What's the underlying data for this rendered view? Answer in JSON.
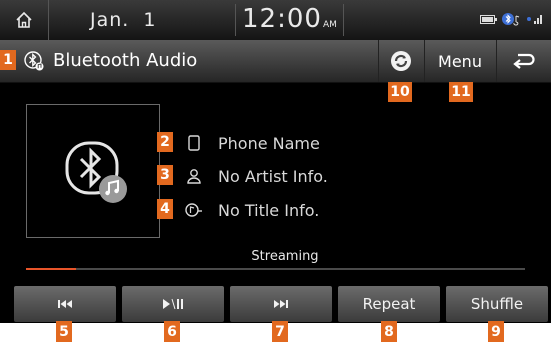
{
  "status_bar": {
    "date": "Jan.  1",
    "time": "12:00",
    "ampm": "AM"
  },
  "header": {
    "source_title": "Bluetooth Audio",
    "menu_label": "Menu"
  },
  "track": {
    "phone_name": "Phone Name",
    "artist": "No Artist Info.",
    "title": "No Title Info.",
    "status": "Streaming",
    "progress_fraction": 0.1
  },
  "controls": {
    "repeat_label": "Repeat",
    "shuffle_label": "Shuffle"
  },
  "callouts": [
    "1",
    "2",
    "3",
    "4",
    "5",
    "6",
    "7",
    "8",
    "9",
    "10",
    "11"
  ],
  "colors": {
    "callout": "#e2691f",
    "progress": "#e8552a"
  },
  "icons": {
    "home": "home-icon",
    "bluetooth": "bluetooth-icon",
    "connection": "bluetooth-connection-icon",
    "back": "back-arrow-icon",
    "phone": "phone-icon",
    "artist": "person-icon",
    "title": "song-title-icon",
    "previous": "skip-previous-icon",
    "play_pause": "play-pause-icon",
    "next": "skip-next-icon"
  }
}
